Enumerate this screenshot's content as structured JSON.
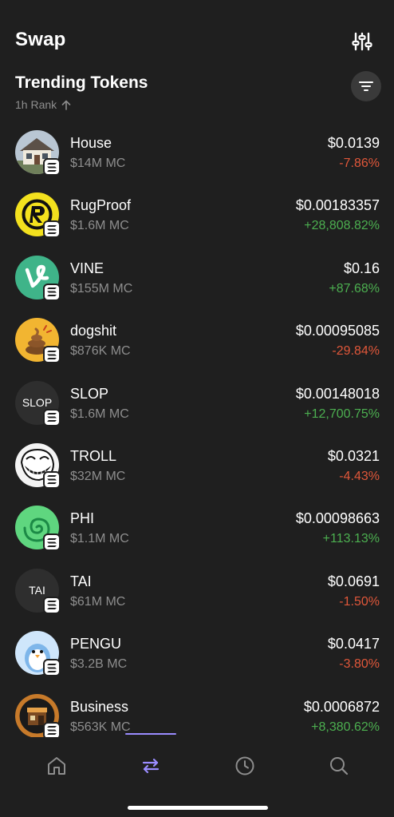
{
  "header": {
    "title": "Swap",
    "settings_icon": "sliders-icon"
  },
  "section": {
    "title": "Trending Tokens",
    "rank_label": "1h Rank",
    "sort_icon": "arrow-up-icon",
    "filter_icon": "filter-icon"
  },
  "colors": {
    "background": "#1f1f1f",
    "negative": "#e0573a",
    "positive": "#4caf50",
    "accent": "#9a8cff",
    "muted": "#8e8e8e"
  },
  "tokens": [
    {
      "name": "House",
      "mc": "$14M MC",
      "price": "$0.0139",
      "change": "-7.86%",
      "direction": "down",
      "icon": "house-photo-icon"
    },
    {
      "name": "RugProof",
      "mc": "$1.6M MC",
      "price": "$0.00183357",
      "change": "+28,808.82%",
      "direction": "up",
      "icon": "rugproof-logo-icon"
    },
    {
      "name": "VINE",
      "mc": "$155M MC",
      "price": "$0.16",
      "change": "+87.68%",
      "direction": "up",
      "icon": "vine-logo-icon"
    },
    {
      "name": "dogshit",
      "mc": "$876K MC",
      "price": "$0.00095085",
      "change": "-29.84%",
      "direction": "down",
      "icon": "poop-icon"
    },
    {
      "name": "SLOP",
      "mc": "$1.6M MC",
      "price": "$0.00148018",
      "change": "+12,700.75%",
      "direction": "up",
      "icon": "text-avatar",
      "avatar_text": "SLOP"
    },
    {
      "name": "TROLL",
      "mc": "$32M MC",
      "price": "$0.0321",
      "change": "-4.43%",
      "direction": "down",
      "icon": "trollface-icon"
    },
    {
      "name": "PHI",
      "mc": "$1.1M MC",
      "price": "$0.00098663",
      "change": "+113.13%",
      "direction": "up",
      "icon": "spiral-icon"
    },
    {
      "name": "TAI",
      "mc": "$61M MC",
      "price": "$0.0691",
      "change": "-1.50%",
      "direction": "down",
      "icon": "text-avatar",
      "avatar_text": "TAI"
    },
    {
      "name": "PENGU",
      "mc": "$3.2B MC",
      "price": "$0.0417",
      "change": "-3.80%",
      "direction": "down",
      "icon": "penguin-icon"
    },
    {
      "name": "Business",
      "mc": "$563K MC",
      "price": "$0.0006872",
      "change": "+8,380.62%",
      "direction": "up",
      "icon": "storefront-icon"
    }
  ],
  "chain_badge_icon": "solana-icon",
  "nav": [
    {
      "name": "home",
      "icon": "home-icon",
      "active": false
    },
    {
      "name": "swap",
      "icon": "swap-icon",
      "active": true
    },
    {
      "name": "activity",
      "icon": "clock-icon",
      "active": false
    },
    {
      "name": "search",
      "icon": "search-icon",
      "active": false
    }
  ]
}
